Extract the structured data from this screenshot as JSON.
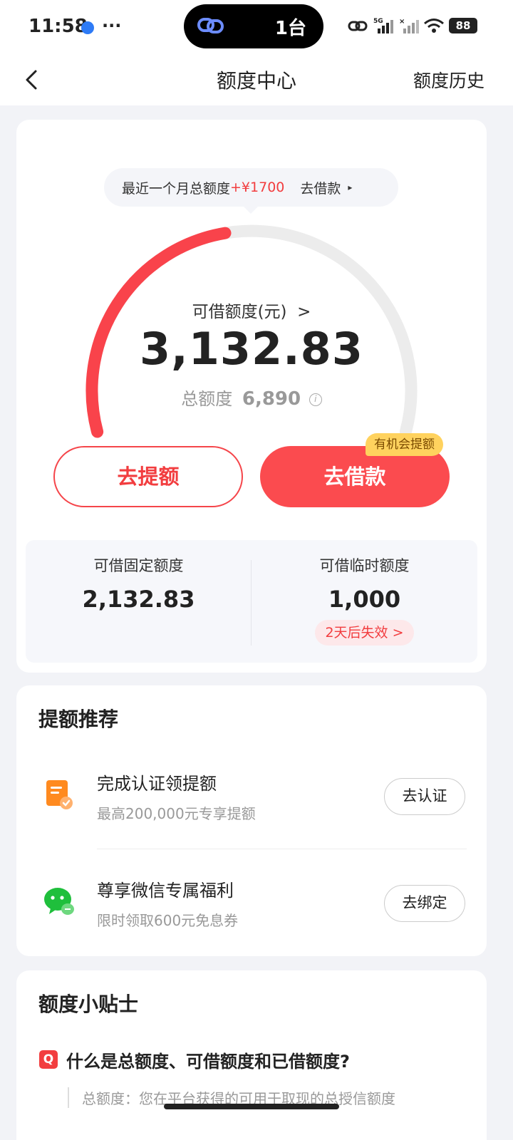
{
  "status_bar": {
    "time": "11:58",
    "more": "···",
    "island_text": "1台",
    "network": "5G",
    "battery": "88"
  },
  "nav": {
    "title": "额度中心",
    "history": "额度历史"
  },
  "quota": {
    "tip_prefix": "最近一个月总额度",
    "tip_increase": "+¥1700",
    "tip_link": "去借款",
    "available_label": "可借额度(元)",
    "available_amount": "3,132.83",
    "total_label": "总额度",
    "total_value": "6,890",
    "available_ratio": 0.4547,
    "raise_button": "去提额",
    "borrow_button": "去借款",
    "borrow_badge": "有机会提额",
    "fixed_label": "可借固定额度",
    "fixed_value": "2,132.83",
    "temp_label": "可借临时额度",
    "temp_value": "1,000",
    "temp_expire": "2天后失效"
  },
  "recommend": {
    "title": "提额推荐",
    "items": [
      {
        "icon": "document-check-icon",
        "title": "完成认证领提额",
        "subtitle": "最高200,000元专享提额",
        "button": "去认证"
      },
      {
        "icon": "wechat-icon",
        "title": "尊享微信专属福利",
        "subtitle": "限时领取600元免息券",
        "button": "去绑定"
      }
    ]
  },
  "tips": {
    "title": "额度小贴士",
    "question": "什么是总额度、可借额度和已借额度?",
    "answer": "总额度：您在平台获得的可用于取现的总授信额度"
  },
  "colors": {
    "accent": "#fb4b4f",
    "badge": "#ffd25e",
    "track": "#ececec"
  }
}
